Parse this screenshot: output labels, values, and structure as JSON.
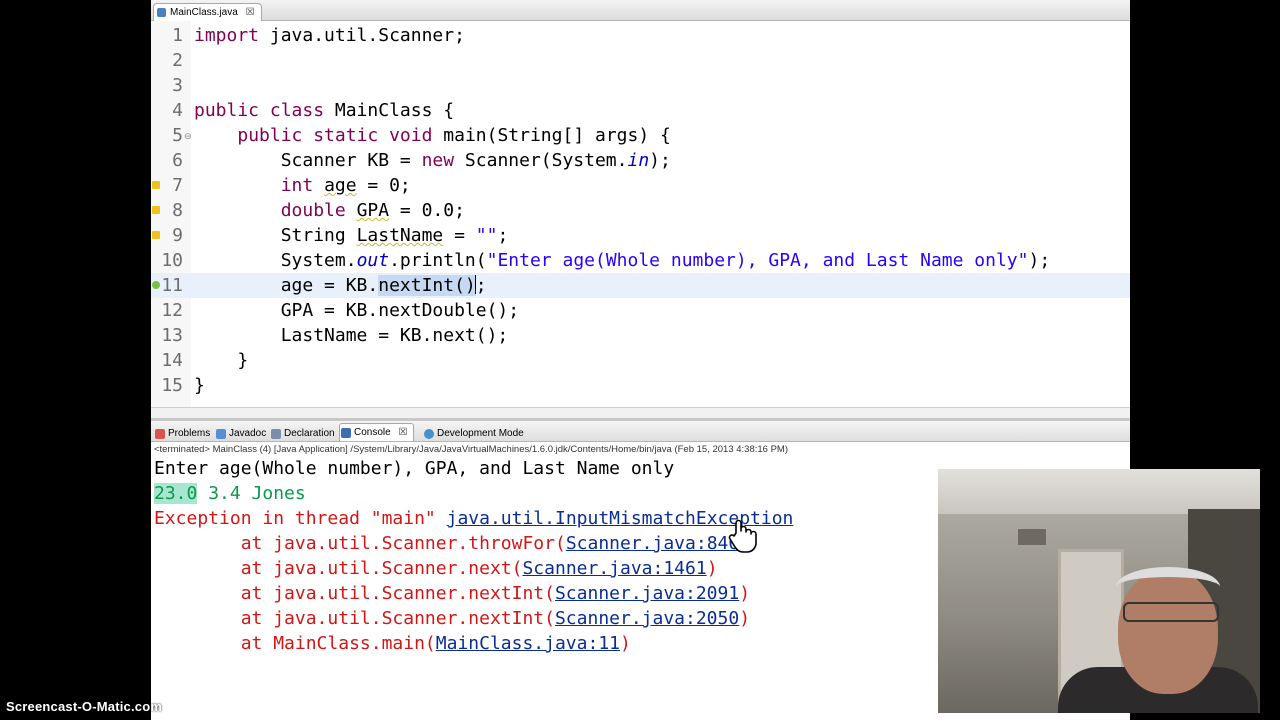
{
  "editor_tab": {
    "label": "MainClass.java",
    "close": "☒"
  },
  "code": [
    {
      "n": "1",
      "t": "import java.util.Scanner;"
    },
    {
      "n": "2",
      "t": ""
    },
    {
      "n": "3",
      "t": ""
    },
    {
      "n": "4",
      "t": "public class MainClass {"
    },
    {
      "n": "5",
      "t": "    public static void main(String[] args) {"
    },
    {
      "n": "6",
      "t": "        Scanner KB = new Scanner(System.in);"
    },
    {
      "n": "7",
      "t": "        int age = 0;"
    },
    {
      "n": "8",
      "t": "        double GPA = 0.0;"
    },
    {
      "n": "9",
      "t": "        String LastName = \"\";"
    },
    {
      "n": "10",
      "t": "        System.out.println(\"Enter age(Whole number), GPA, and Last Name only\");"
    },
    {
      "n": "11",
      "t": "        age = KB.nextInt();"
    },
    {
      "n": "12",
      "t": "        GPA = KB.nextDouble();"
    },
    {
      "n": "13",
      "t": "        LastName = KB.next();"
    },
    {
      "n": "14",
      "t": "    }"
    },
    {
      "n": "15",
      "t": "}"
    }
  ],
  "view_tabs": {
    "problems": "Problems",
    "javadoc": "Javadoc",
    "declaration": "Declaration",
    "console": "Console",
    "devmode": "Development Mode"
  },
  "console_status": "<terminated> MainClass (4) [Java Application] /System/Library/Java/JavaVirtualMachines/1.6.0.jdk/Contents/Home/bin/java (Feb 15, 2013 4:38:16 PM)",
  "console": {
    "prompt": "Enter age(Whole number), GPA, and Last Name only",
    "input_first": "23.0",
    "input_rest": " 3.4 Jones",
    "exc_prefix": "Exception in thread \"main\" ",
    "exc_name": "java.util.InputMismatchException",
    "trace": [
      {
        "pre": "        at java.util.Scanner.throwFor(",
        "link": "Scanner.java:840",
        "post": ")"
      },
      {
        "pre": "        at java.util.Scanner.next(",
        "link": "Scanner.java:1461",
        "post": ")"
      },
      {
        "pre": "        at java.util.Scanner.nextInt(",
        "link": "Scanner.java:2091",
        "post": ")"
      },
      {
        "pre": "        at java.util.Scanner.nextInt(",
        "link": "Scanner.java:2050",
        "post": ")"
      },
      {
        "pre": "        at MainClass.main(",
        "link": "MainClass.java:11",
        "post": ")"
      }
    ]
  },
  "watermark": "Screencast-O-Matic.com",
  "colors": {
    "keyword": "#7f0055",
    "string": "#2a00ff",
    "error": "#d21616",
    "link": "#0a2d93"
  }
}
